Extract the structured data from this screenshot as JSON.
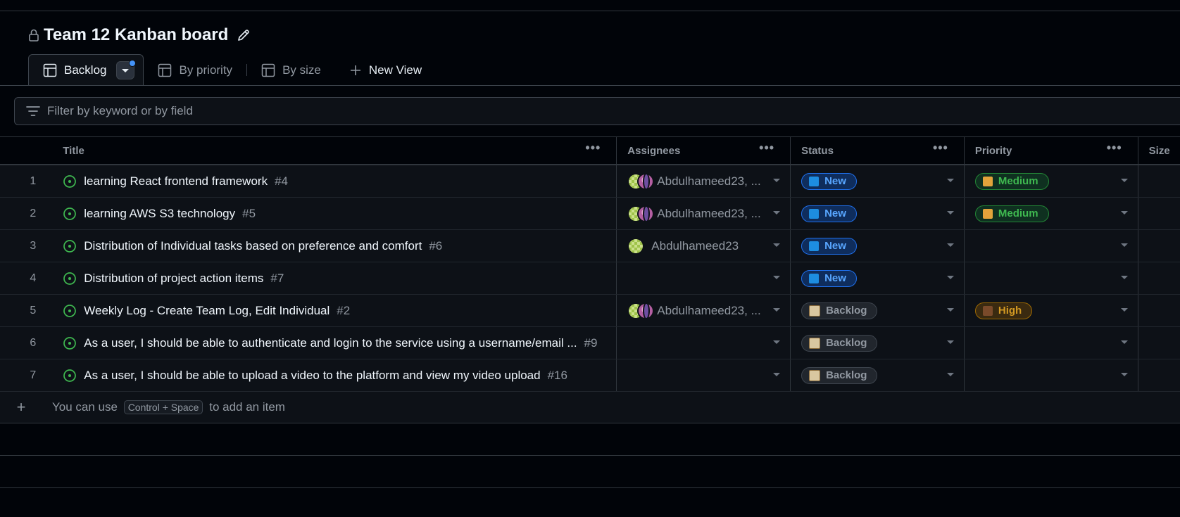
{
  "board": {
    "title": "Team 12 Kanban board"
  },
  "tabs": [
    {
      "label": "Backlog",
      "active": true
    },
    {
      "label": "By priority"
    },
    {
      "label": "By size"
    },
    {
      "label": "New View"
    }
  ],
  "filter": {
    "placeholder": "Filter by keyword or by field"
  },
  "columns": {
    "title": "Title",
    "assignees": "Assignees",
    "status": "Status",
    "priority": "Priority",
    "size": "Size"
  },
  "rows": [
    {
      "num": "1",
      "title": "learning React frontend framework",
      "issue": "#4",
      "assignees": "Abdulhameed23, ...",
      "status": "New",
      "priority": "Medium"
    },
    {
      "num": "2",
      "title": "learning AWS S3 technology",
      "issue": "#5",
      "assignees": "Abdulhameed23, ...",
      "status": "New",
      "priority": "Medium"
    },
    {
      "num": "3",
      "title": "Distribution of Individual tasks based on preference and comfort",
      "issue": "#6",
      "assignees": "Abdulhameed23",
      "status": "New",
      "priority": ""
    },
    {
      "num": "4",
      "title": "Distribution of project action items",
      "issue": "#7",
      "assignees": "",
      "status": "New",
      "priority": ""
    },
    {
      "num": "5",
      "title": "Weekly Log - Create Team Log, Edit Individual",
      "issue": "#2",
      "assignees": "Abdulhameed23, ...",
      "status": "Backlog",
      "priority": "High"
    },
    {
      "num": "6",
      "title": "As a user, I should be able to authenticate and login to the service using a username/email ...",
      "issue": "#9",
      "assignees": "",
      "status": "Backlog",
      "priority": ""
    },
    {
      "num": "7",
      "title": "As a user, I should be able to upload a video to the platform and view my video upload",
      "issue": "#16",
      "assignees": "",
      "status": "Backlog",
      "priority": ""
    }
  ],
  "add_item": {
    "prefix": "You can use",
    "shortcut": "Control + Space",
    "suffix": "to add an item"
  },
  "colors": {
    "background": "#010409",
    "surface": "#0d1117",
    "open_issue": "#3fb950",
    "new_badge": "#58a6ff",
    "medium_badge": "#3fb950",
    "high_badge": "#d29922"
  }
}
